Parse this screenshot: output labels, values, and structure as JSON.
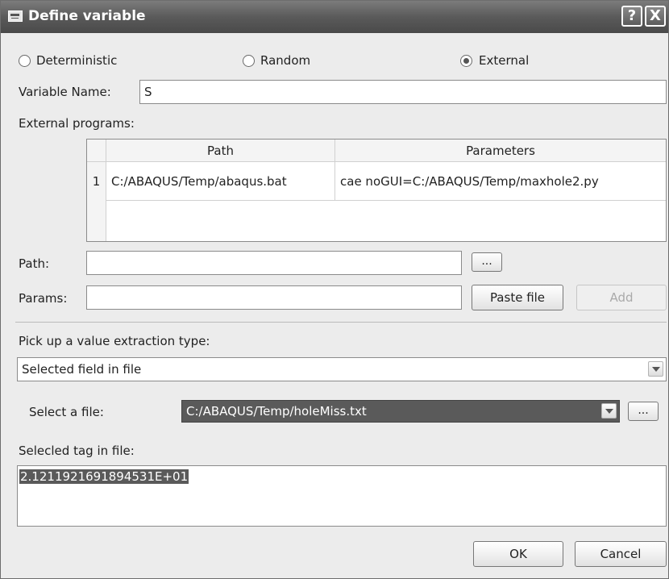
{
  "window": {
    "title": "Define variable",
    "help_label": "?",
    "close_label": "X"
  },
  "type_options": {
    "deterministic": "Deterministic",
    "random": "Random",
    "external": "External",
    "selected": "External"
  },
  "variable_name": {
    "label": "Variable Name:",
    "value": "S"
  },
  "external_programs": {
    "label": "External programs:",
    "columns": [
      "Path",
      "Parameters"
    ],
    "rows": [
      {
        "index": "1",
        "path": "C:/ABAQUS/Temp/abaqus.bat",
        "parameters": "cae noGUI=C:/ABAQUS/Temp/maxhole2.py"
      }
    ]
  },
  "path_field": {
    "label": "Path:",
    "value": "",
    "browse_label": "..."
  },
  "params_field": {
    "label": "Params:",
    "value": "",
    "paste_label": "Paste file",
    "add_label": "Add"
  },
  "extraction": {
    "label": "Pick up a value extraction type:",
    "selected": "Selected field in file"
  },
  "file_select": {
    "label": "Select a file:",
    "value": "C:/ABAQUS/Temp/holeMiss.txt",
    "browse_label": "..."
  },
  "tag": {
    "label": "Selecled tag in file:",
    "value": "2.1211921691894531E+01"
  },
  "footer": {
    "ok_label": "OK",
    "cancel_label": "Cancel"
  }
}
